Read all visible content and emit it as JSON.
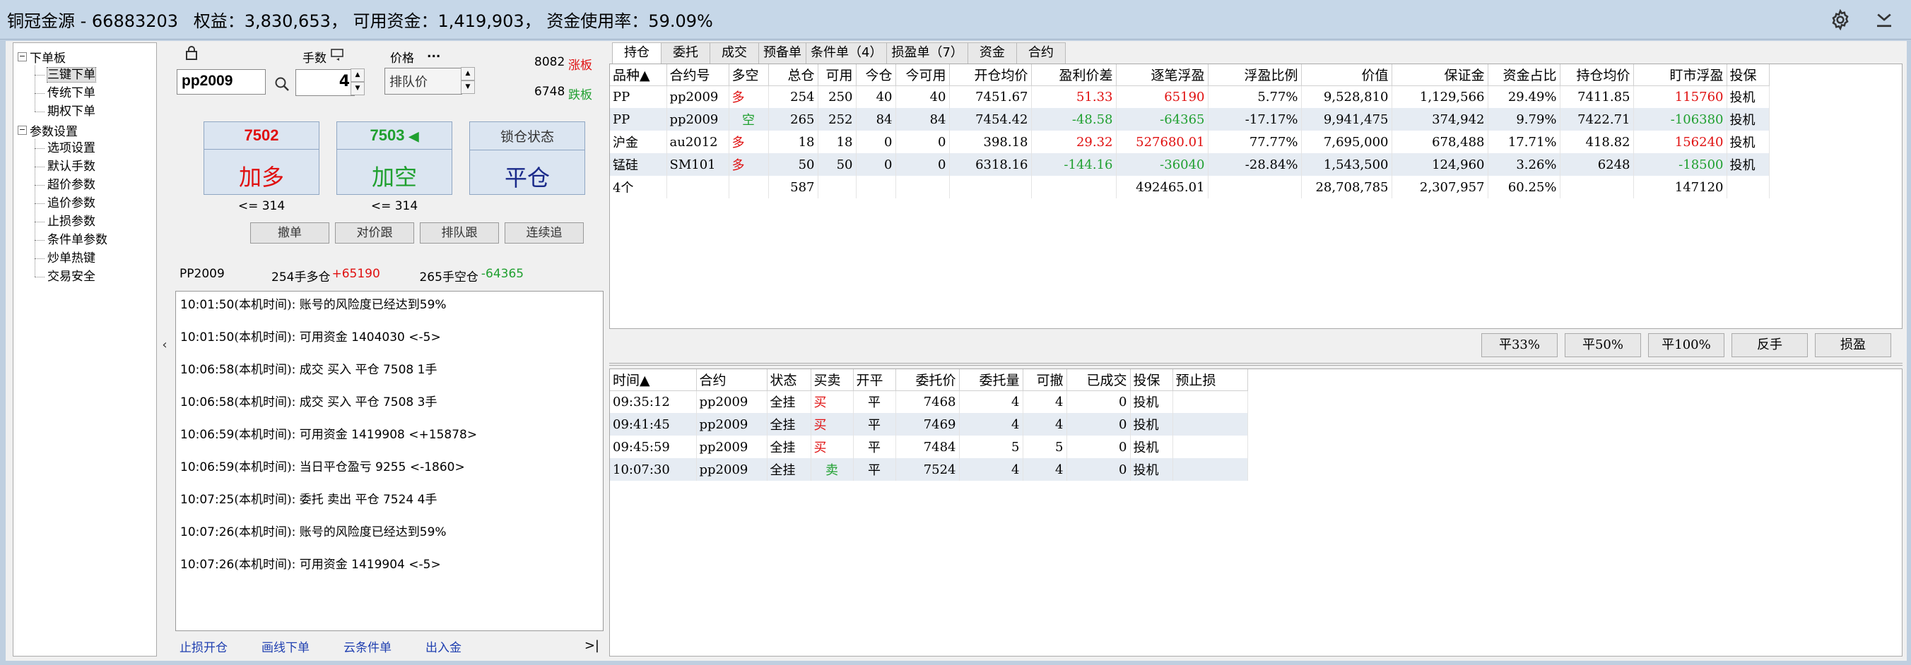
{
  "titlebar": {
    "broker": "铜冠金源 - 66883203",
    "equity": "权益：3,830,653，",
    "available": "可用资金：1,419,903，",
    "usage": "资金使用率：59.09%"
  },
  "tree": {
    "groups": [
      {
        "label": "下单板",
        "items": [
          "三键下单",
          "传统下单",
          "期权下单"
        ]
      },
      {
        "label": "参数设置",
        "items": [
          "选项设置",
          "默认手数",
          "超价参数",
          "追价参数",
          "止损参数",
          "条件单参数",
          "炒单热键",
          "交易安全"
        ]
      }
    ]
  },
  "order": {
    "code": "pp2009",
    "qty_label": "手数",
    "qty": "4",
    "price_label": "价格",
    "price_more": "...",
    "price_placeholder": "排队价",
    "upper_limit": "8082",
    "upper_label": "涨板",
    "lower_limit": "6748",
    "lower_label": "跌板",
    "buy": {
      "price": "7502",
      "label": "加多",
      "note": "<= 314"
    },
    "sell": {
      "price": "7503",
      "label": "加空",
      "note": "<= 314"
    },
    "lock": {
      "title": "锁仓状态",
      "label": "平仓"
    },
    "buttons": [
      "撤单",
      "对价跟",
      "排队跟",
      "连续追"
    ]
  },
  "summary": {
    "code": "PP2009",
    "long": "254手多仓",
    "long_pl": "+65190",
    "short": "265手空仓",
    "short_pl": "-64365"
  },
  "log": [
    {
      "time": "10:01:50",
      "tag": "(本机时间)",
      "msg": ": 账号的风险度已经达到59%"
    },
    {
      "time": "10:01:50",
      "tag": "(本机时间)",
      "msg": ": 可用资金 1404030  <-5>"
    },
    {
      "time": "10:06:58",
      "tag": "(本机时间)",
      "msg": ": 成交  买入  平仓  7508  1手"
    },
    {
      "time": "10:06:58",
      "tag": "(本机时间)",
      "msg": ": 成交  买入  平仓  7508  3手"
    },
    {
      "time": "10:06:59",
      "tag": "(本机时间)",
      "msg": ": 可用资金 1419908  <+15878>"
    },
    {
      "time": "10:06:59",
      "tag": "(本机时间)",
      "msg": ": 当日平仓盈亏 9255  <-1860>"
    },
    {
      "time": "10:07:25",
      "tag": "(本机时间)",
      "msg": ": 委托  卖出  平仓  7524  4手"
    },
    {
      "time": "10:07:26",
      "tag": "(本机时间)",
      "msg": ": 账号的风险度已经达到59%"
    },
    {
      "time": "10:07:26",
      "tag": "(本机时间)",
      "msg": ": 可用资金 1419904  <-5>"
    }
  ],
  "bottom_links": [
    "止损开仓",
    "画线下单",
    "云条件单",
    "出入金"
  ],
  "goto_end": ">|",
  "tabs": [
    "持仓",
    "委托",
    "成交",
    "预备单",
    "条件单（4）",
    "损盈单（7）",
    "资金",
    "合约"
  ],
  "positions": {
    "headers": [
      "品种▲",
      "合约号",
      "多空",
      "总仓",
      "可用",
      "今仓",
      "今可用",
      "开仓均价",
      "盈利价差",
      "逐笔浮盈",
      "浮盈比例",
      "价值",
      "保证金",
      "资金占比",
      "持仓均价",
      "盯市浮盈",
      "投保"
    ],
    "rows": [
      [
        "PP",
        "pp2009",
        "多",
        "254",
        "250",
        "40",
        "40",
        "7451.67",
        "51.33",
        "65190",
        "5.77%",
        "9,528,810",
        "1,129,566",
        "29.49%",
        "7411.85",
        "115760",
        "投机"
      ],
      [
        "PP",
        "pp2009",
        "空",
        "265",
        "252",
        "84",
        "84",
        "7454.42",
        "-48.58",
        "-64365",
        "-17.17%",
        "9,941,475",
        "374,942",
        "9.79%",
        "7422.71",
        "-106380",
        "投机"
      ],
      [
        "沪金",
        "au2012",
        "多",
        "18",
        "18",
        "0",
        "0",
        "398.18",
        "29.32",
        "527680.01",
        "77.77%",
        "7,695,000",
        "678,488",
        "17.71%",
        "418.82",
        "156240",
        "投机"
      ],
      [
        "锰硅",
        "SM101",
        "多",
        "50",
        "50",
        "0",
        "0",
        "6318.16",
        "-144.16",
        "-36040",
        "-28.84%",
        "1,543,500",
        "124,960",
        "3.26%",
        "6248",
        "-18500",
        "投机"
      ]
    ],
    "total": [
      "4个",
      "",
      "",
      "587",
      "",
      "",
      "",
      "",
      "",
      "492465.01",
      "",
      "28,708,785",
      "2,307,957",
      "60.25%",
      "",
      "147120",
      ""
    ]
  },
  "actions": [
    "平33%",
    "平50%",
    "平100%",
    "反手",
    "损盈"
  ],
  "orders": {
    "headers": [
      "时间▲",
      "合约",
      "状态",
      "买卖",
      "开平",
      "委托价",
      "委托量",
      "可撤",
      "已成交",
      "投保",
      "预止损"
    ],
    "rows": [
      [
        "09:35:12",
        "pp2009",
        "全挂",
        "买",
        "平",
        "7468",
        "4",
        "4",
        "0",
        "投机",
        ""
      ],
      [
        "09:41:45",
        "pp2009",
        "全挂",
        "买",
        "平",
        "7469",
        "4",
        "4",
        "0",
        "投机",
        ""
      ],
      [
        "09:45:59",
        "pp2009",
        "全挂",
        "买",
        "平",
        "7484",
        "5",
        "5",
        "0",
        "投机",
        ""
      ],
      [
        "10:07:30",
        "pp2009",
        "全挂",
        "卖",
        "平",
        "7524",
        "4",
        "4",
        "0",
        "投机",
        ""
      ]
    ]
  },
  "colors": {
    "up": "#e01010",
    "down": "#20a030",
    "link": "#1f3fb0",
    "title_bg": "#c6d7e8"
  }
}
